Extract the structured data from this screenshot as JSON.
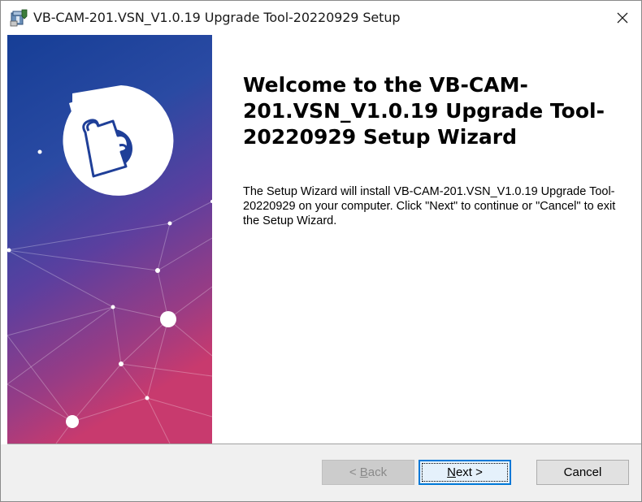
{
  "window": {
    "title": "VB-CAM-201.VSN_V1.0.19 Upgrade Tool-20220929 Setup",
    "close_glyph": "✕",
    "icon": "installer-box-icon"
  },
  "main": {
    "heading": "Welcome to the VB-CAM-201.VSN_V1.0.19 Upgrade Tool-20220929 Setup Wizard",
    "description": "The Setup Wizard will install VB-CAM-201.VSN_V1.0.19 Upgrade Tool-20220929 on your computer.  Click \"Next\" to continue or \"Cancel\" to exit the Setup Wizard."
  },
  "banner": {
    "logo_icon": "puzzle-piece-icon",
    "gradient_top": "#1a3f96",
    "gradient_mid": "#5a3f9e",
    "gradient_bottom": "#c83a6e"
  },
  "buttons": {
    "back": {
      "prefix": "< ",
      "accel": "B",
      "rest": "ack",
      "enabled": false
    },
    "next": {
      "accel": "N",
      "rest": "ext >",
      "enabled": true
    },
    "cancel": {
      "label": "Cancel",
      "enabled": true
    }
  },
  "colors": {
    "focus_border": "#0078d7",
    "footer_bg": "#f0f0f0"
  }
}
